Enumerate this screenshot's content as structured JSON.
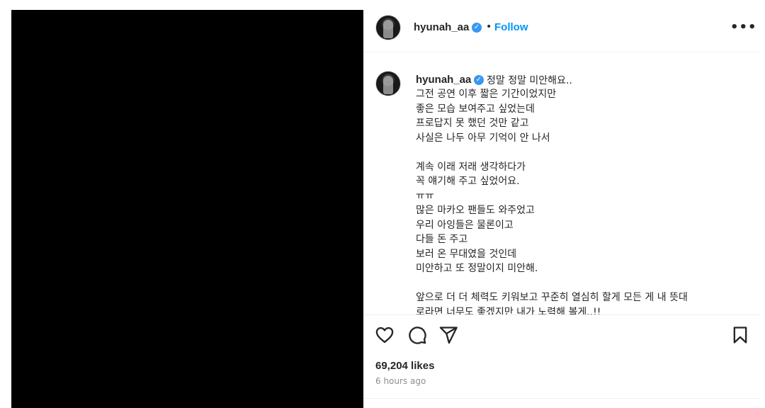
{
  "post": {
    "username": "hyunah_aa",
    "verified_icon": "verified-badge-icon",
    "separator": "•",
    "follow_label": "Follow",
    "more_label": "•••",
    "caption_first_line": "정말 정말 미안해요..",
    "caption_lines": [
      "그전 공연 이후 짧은 기간이었지만",
      "좋은 모습 보여주고 싶었는데",
      "프로답지 못 했던 것만 같고",
      "사실은 나두 아무 기억이 안 나서",
      "",
      "계속 이래 저래 생각하다가",
      "꼭 얘기해 주고 싶었어요.",
      "ㅠㅠ",
      "많은 마카오 팬들도 와주었고",
      "우리 아잉들은 물론이고",
      "다들 돈 주고",
      "보러 온 무대였을 것인데",
      "미안하고 또 정말이지 미안해.",
      "",
      "앞으로  더 더 체력도 키워보고 꾸준히 열심히 할게 모든 게 내 뜻대",
      "로라면  너무도 좋겠지만 내가 노력해 볼게..!!"
    ],
    "likes": "69,204 likes",
    "time": "6 hours ago",
    "icons": {
      "like": "heart-icon",
      "comment": "comment-bubble-icon",
      "share": "send-paper-plane-icon",
      "save": "bookmark-icon"
    },
    "colors": {
      "accent": "#0095f6",
      "verified": "#3897f0",
      "text": "#262626",
      "muted": "#8e8e8e",
      "media_bg": "#000000"
    }
  }
}
